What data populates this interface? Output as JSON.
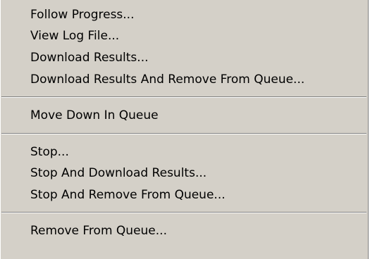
{
  "menu": {
    "group_1": [
      {
        "label": "Follow Progress..."
      },
      {
        "label": "View Log File..."
      },
      {
        "label": "Download Results..."
      },
      {
        "label": "Download Results And Remove From Queue..."
      }
    ],
    "group_2": [
      {
        "label": "Move Down In Queue"
      }
    ],
    "group_3": [
      {
        "label": "Stop..."
      },
      {
        "label": "Stop And Download Results..."
      },
      {
        "label": "Stop And Remove From Queue..."
      }
    ],
    "group_4": [
      {
        "label": "Remove From Queue..."
      }
    ]
  }
}
